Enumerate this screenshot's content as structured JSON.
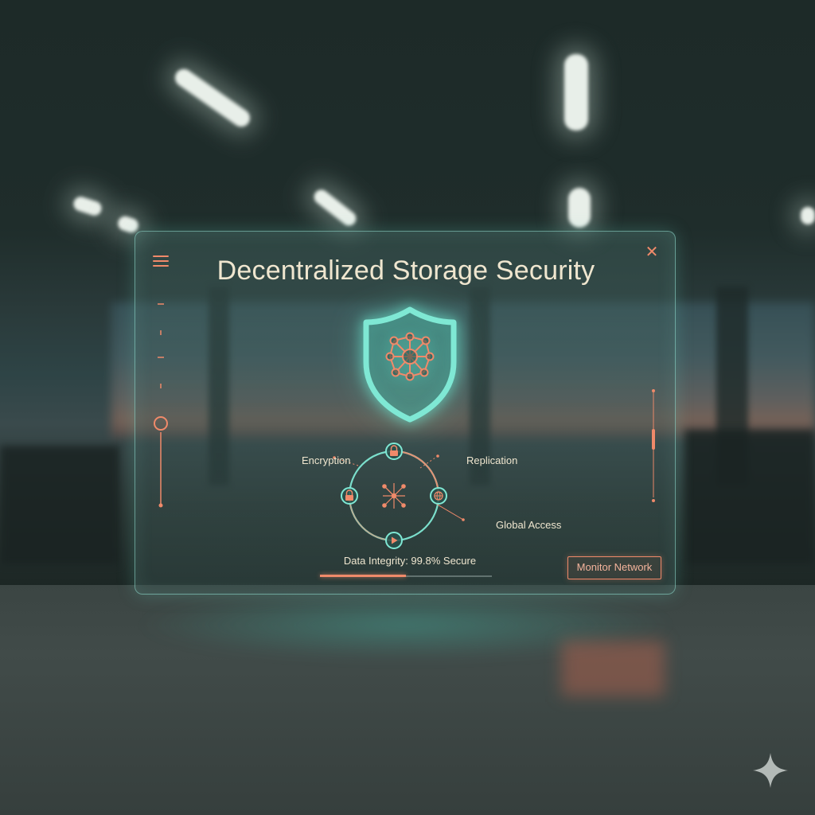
{
  "window": {
    "title": "Decentralized Storage Security",
    "menu_icon": "hamburger-menu-icon",
    "close_icon": "close-icon",
    "close_glyph": "✕"
  },
  "hero": {
    "icon": "shield-network-icon"
  },
  "features": {
    "encryption": "Encryption",
    "replication": "Replication",
    "global_access": "Global Access",
    "node_icons": [
      "lock-icon",
      "lock-icon",
      "globe-icon",
      "play-icon",
      "network-hub-icon"
    ]
  },
  "integrity": {
    "label": "Data Integrity: 99.8% Secure",
    "progress_fraction": 0.5
  },
  "actions": {
    "monitor_label": "Monitor Network"
  },
  "colors": {
    "accent_teal": "#7fe8d4",
    "accent_orange": "#f08a6a",
    "text_cream": "#efe6cf"
  }
}
